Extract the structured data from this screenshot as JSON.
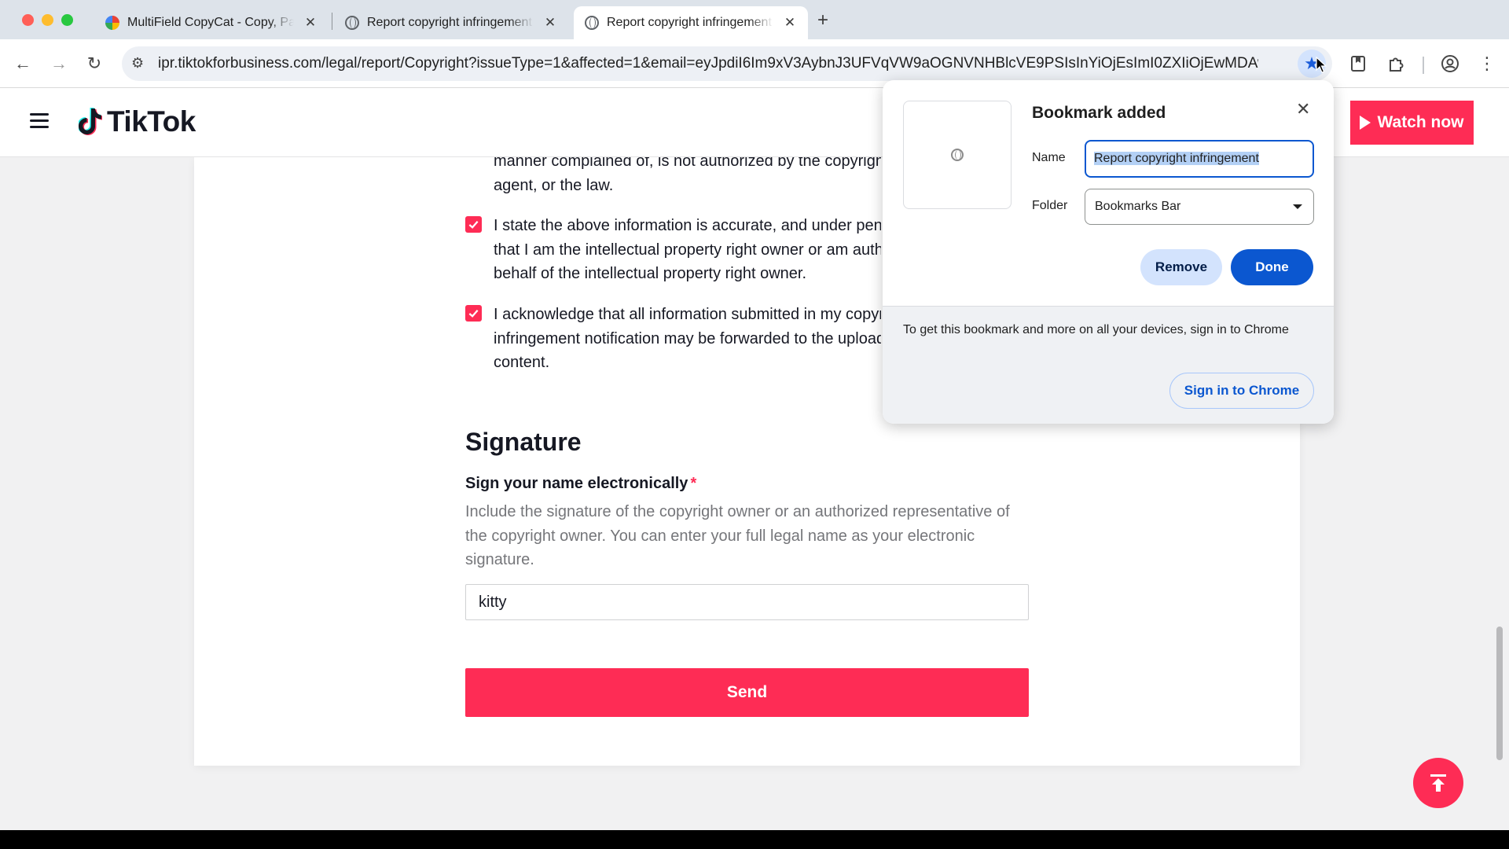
{
  "browser": {
    "tabs": [
      {
        "title": "MultiField CopyCat - Copy, Paste",
        "active": false
      },
      {
        "title": "Report copyright infringement",
        "active": false
      },
      {
        "title": "Report copyright infringement",
        "active": true
      }
    ],
    "url": "ipr.tiktokforbusiness.com/legal/report/Copyright?issueType=1&affected=1&email=eyJpdiI6Im9xV3AybnJ3UFVqVW9aOGNVNHBlcVE9PSIsInYiOjEsImI0ZXIiOjEwMDAwLCJ..."
  },
  "site": {
    "logo_text": "TikTok",
    "watch_now_label": "Watch now"
  },
  "form": {
    "partial_statement_lines": [
      "manner complained of, is not authorized by the copyright owner, its",
      "agent, or the law."
    ],
    "statements": [
      {
        "checked": true,
        "lines": [
          "I state the above information is accurate, and under penalty of perjury,",
          "that I am the intellectual property right owner or am authorized to act on",
          "behalf of the intellectual property right owner."
        ]
      },
      {
        "checked": true,
        "lines": [
          "I acknowledge that all information submitted in my copyright",
          "infringement notification may be forwarded to the uploader of the",
          "content."
        ]
      }
    ],
    "signature": {
      "title": "Signature",
      "label": "Sign your name electronically",
      "required_mark": "*",
      "help": "Include the signature of the copyright owner or an authorized representative of the copyright owner. You can enter your full legal name as your electronic signature.",
      "value": "kitty"
    },
    "send_label": "Send"
  },
  "bookmark_bubble": {
    "title": "Bookmark added",
    "name_label": "Name",
    "name_value": "Report copyright infringement",
    "folder_label": "Folder",
    "folder_value": "Bookmarks Bar",
    "remove_label": "Remove",
    "done_label": "Done",
    "sync_text": "To get this bookmark and more on all your devices, sign in to Chrome",
    "signin_label": "Sign in to Chrome"
  },
  "colors": {
    "tiktok_red": "#fe2c55",
    "chrome_blue": "#0b57d0",
    "tab_strip": "#dde3ea"
  },
  "icons": [
    "back-icon",
    "forward-icon",
    "reload-icon",
    "site-info-icon",
    "bookmark-star-icon",
    "reading-list-icon",
    "extensions-icon",
    "profile-icon",
    "menu-icon",
    "hamburger-icon",
    "back-to-top-icon",
    "close-icon"
  ]
}
